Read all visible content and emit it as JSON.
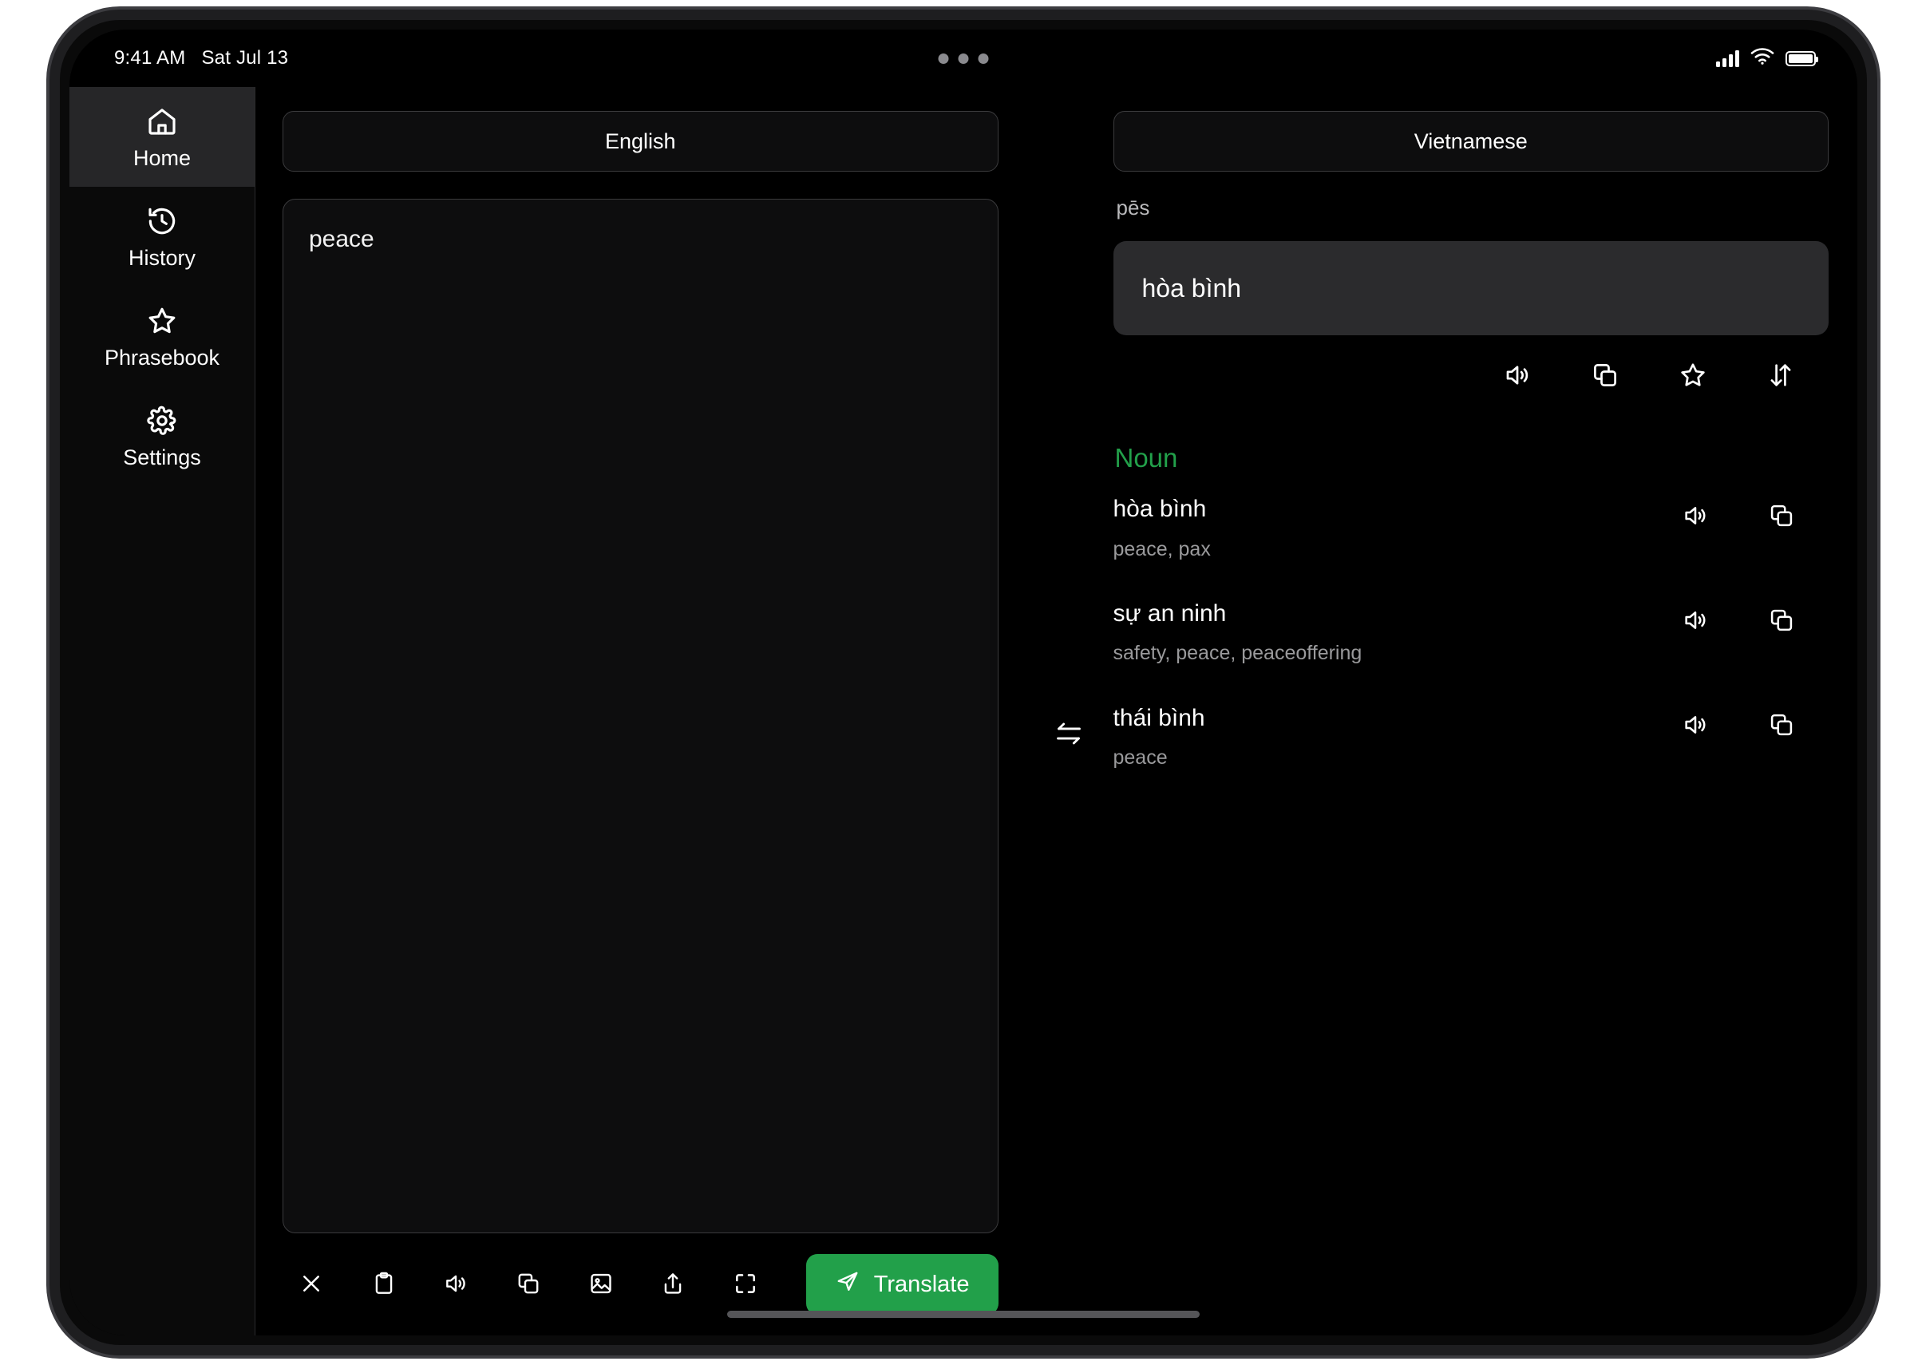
{
  "status_bar": {
    "time": "9:41 AM",
    "date": "Sat Jul 13",
    "cellular_icon": "cellular-bars-icon",
    "wifi_icon": "wifi-icon",
    "battery_icon": "battery-full-icon",
    "multitask_icon": "multitask-dots-icon"
  },
  "sidebar": {
    "items": [
      {
        "label": "Home",
        "icon": "home-icon",
        "active": true
      },
      {
        "label": "History",
        "icon": "history-clock-icon",
        "active": false
      },
      {
        "label": "Phrasebook",
        "icon": "star-icon",
        "active": false
      },
      {
        "label": "Settings",
        "icon": "gear-icon",
        "active": false
      }
    ]
  },
  "source": {
    "language": "English",
    "text": "peace"
  },
  "swap": {
    "icon": "swap-horizontal-icon"
  },
  "target": {
    "language": "Vietnamese",
    "pronunciation": "pēs",
    "translation": "hòa bình",
    "actions": [
      {
        "name": "speak",
        "icon": "speaker-icon"
      },
      {
        "name": "copy",
        "icon": "copy-icon"
      },
      {
        "name": "favorite",
        "icon": "star-icon"
      },
      {
        "name": "sort",
        "icon": "arrows-up-down-icon"
      }
    ],
    "part_of_speech": "Noun",
    "definitions": [
      {
        "term": "hòa bình",
        "gloss": "peace, pax"
      },
      {
        "term": "sự an ninh",
        "gloss": "safety, peace, peaceoffering"
      },
      {
        "term": "thái bình",
        "gloss": "peace"
      }
    ],
    "row_actions": [
      {
        "name": "speak",
        "icon": "speaker-icon"
      },
      {
        "name": "copy",
        "icon": "copy-icon"
      }
    ]
  },
  "toolbar": {
    "icons": [
      {
        "name": "clear",
        "icon": "close-x-icon"
      },
      {
        "name": "paste",
        "icon": "clipboard-icon"
      },
      {
        "name": "speak",
        "icon": "speaker-icon"
      },
      {
        "name": "copy",
        "icon": "copy-icon"
      },
      {
        "name": "image",
        "icon": "image-icon"
      },
      {
        "name": "share",
        "icon": "share-upload-icon"
      },
      {
        "name": "fullscreen",
        "icon": "fullscreen-icon"
      }
    ],
    "translate_label": "Translate",
    "translate_icon": "send-plane-icon"
  },
  "colors": {
    "accent_green": "#22a04a",
    "screen_bg": "#0a0a0a",
    "panel_bg": "#0d0d0e",
    "result_bg": "#2b2b2d",
    "sidebar_active": "#262628",
    "border": "#3b3b3d",
    "muted_text": "#9a9a9c"
  }
}
